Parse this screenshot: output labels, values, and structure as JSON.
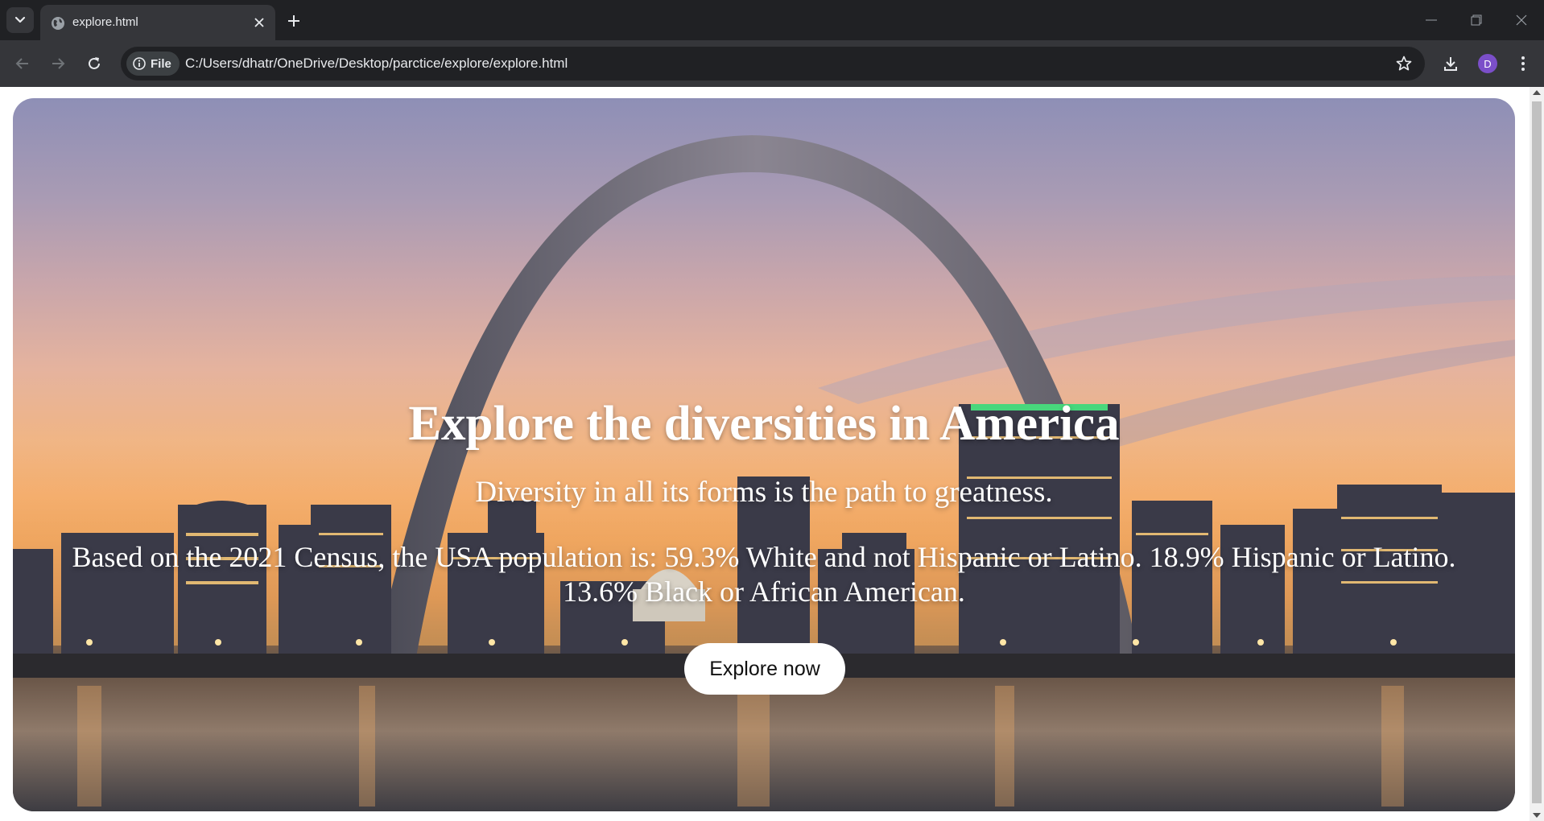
{
  "browser": {
    "tab": {
      "title": "explore.html"
    },
    "address": {
      "security_chip": "File",
      "url": "C:/Users/dhatr/OneDrive/Desktop/parctice/explore/explore.html"
    },
    "profile_initial": "D"
  },
  "hero": {
    "headline": "Explore the diversities in America",
    "tagline": "Diversity in all its forms is the path to greatness.",
    "stats": "Based on the 2021 Census, the USA population is: 59.3% White and not Hispanic or Latino. 18.9% Hispanic or Latino. 13.6% Black or African American.",
    "cta_label": "Explore now"
  },
  "colors": {
    "chrome_dark": "#202124",
    "chrome_toolbar": "#35363a",
    "accent_avatar": "#7b4fc9",
    "hero_text": "#ffffff"
  },
  "icons": [
    "tab-search-icon",
    "globe-icon",
    "close-icon",
    "plus-icon",
    "minimize-icon",
    "restore-icon",
    "window-close-icon",
    "back-icon",
    "forward-icon",
    "reload-icon",
    "info-icon",
    "star-icon",
    "download-icon",
    "kebab-menu-icon"
  ]
}
